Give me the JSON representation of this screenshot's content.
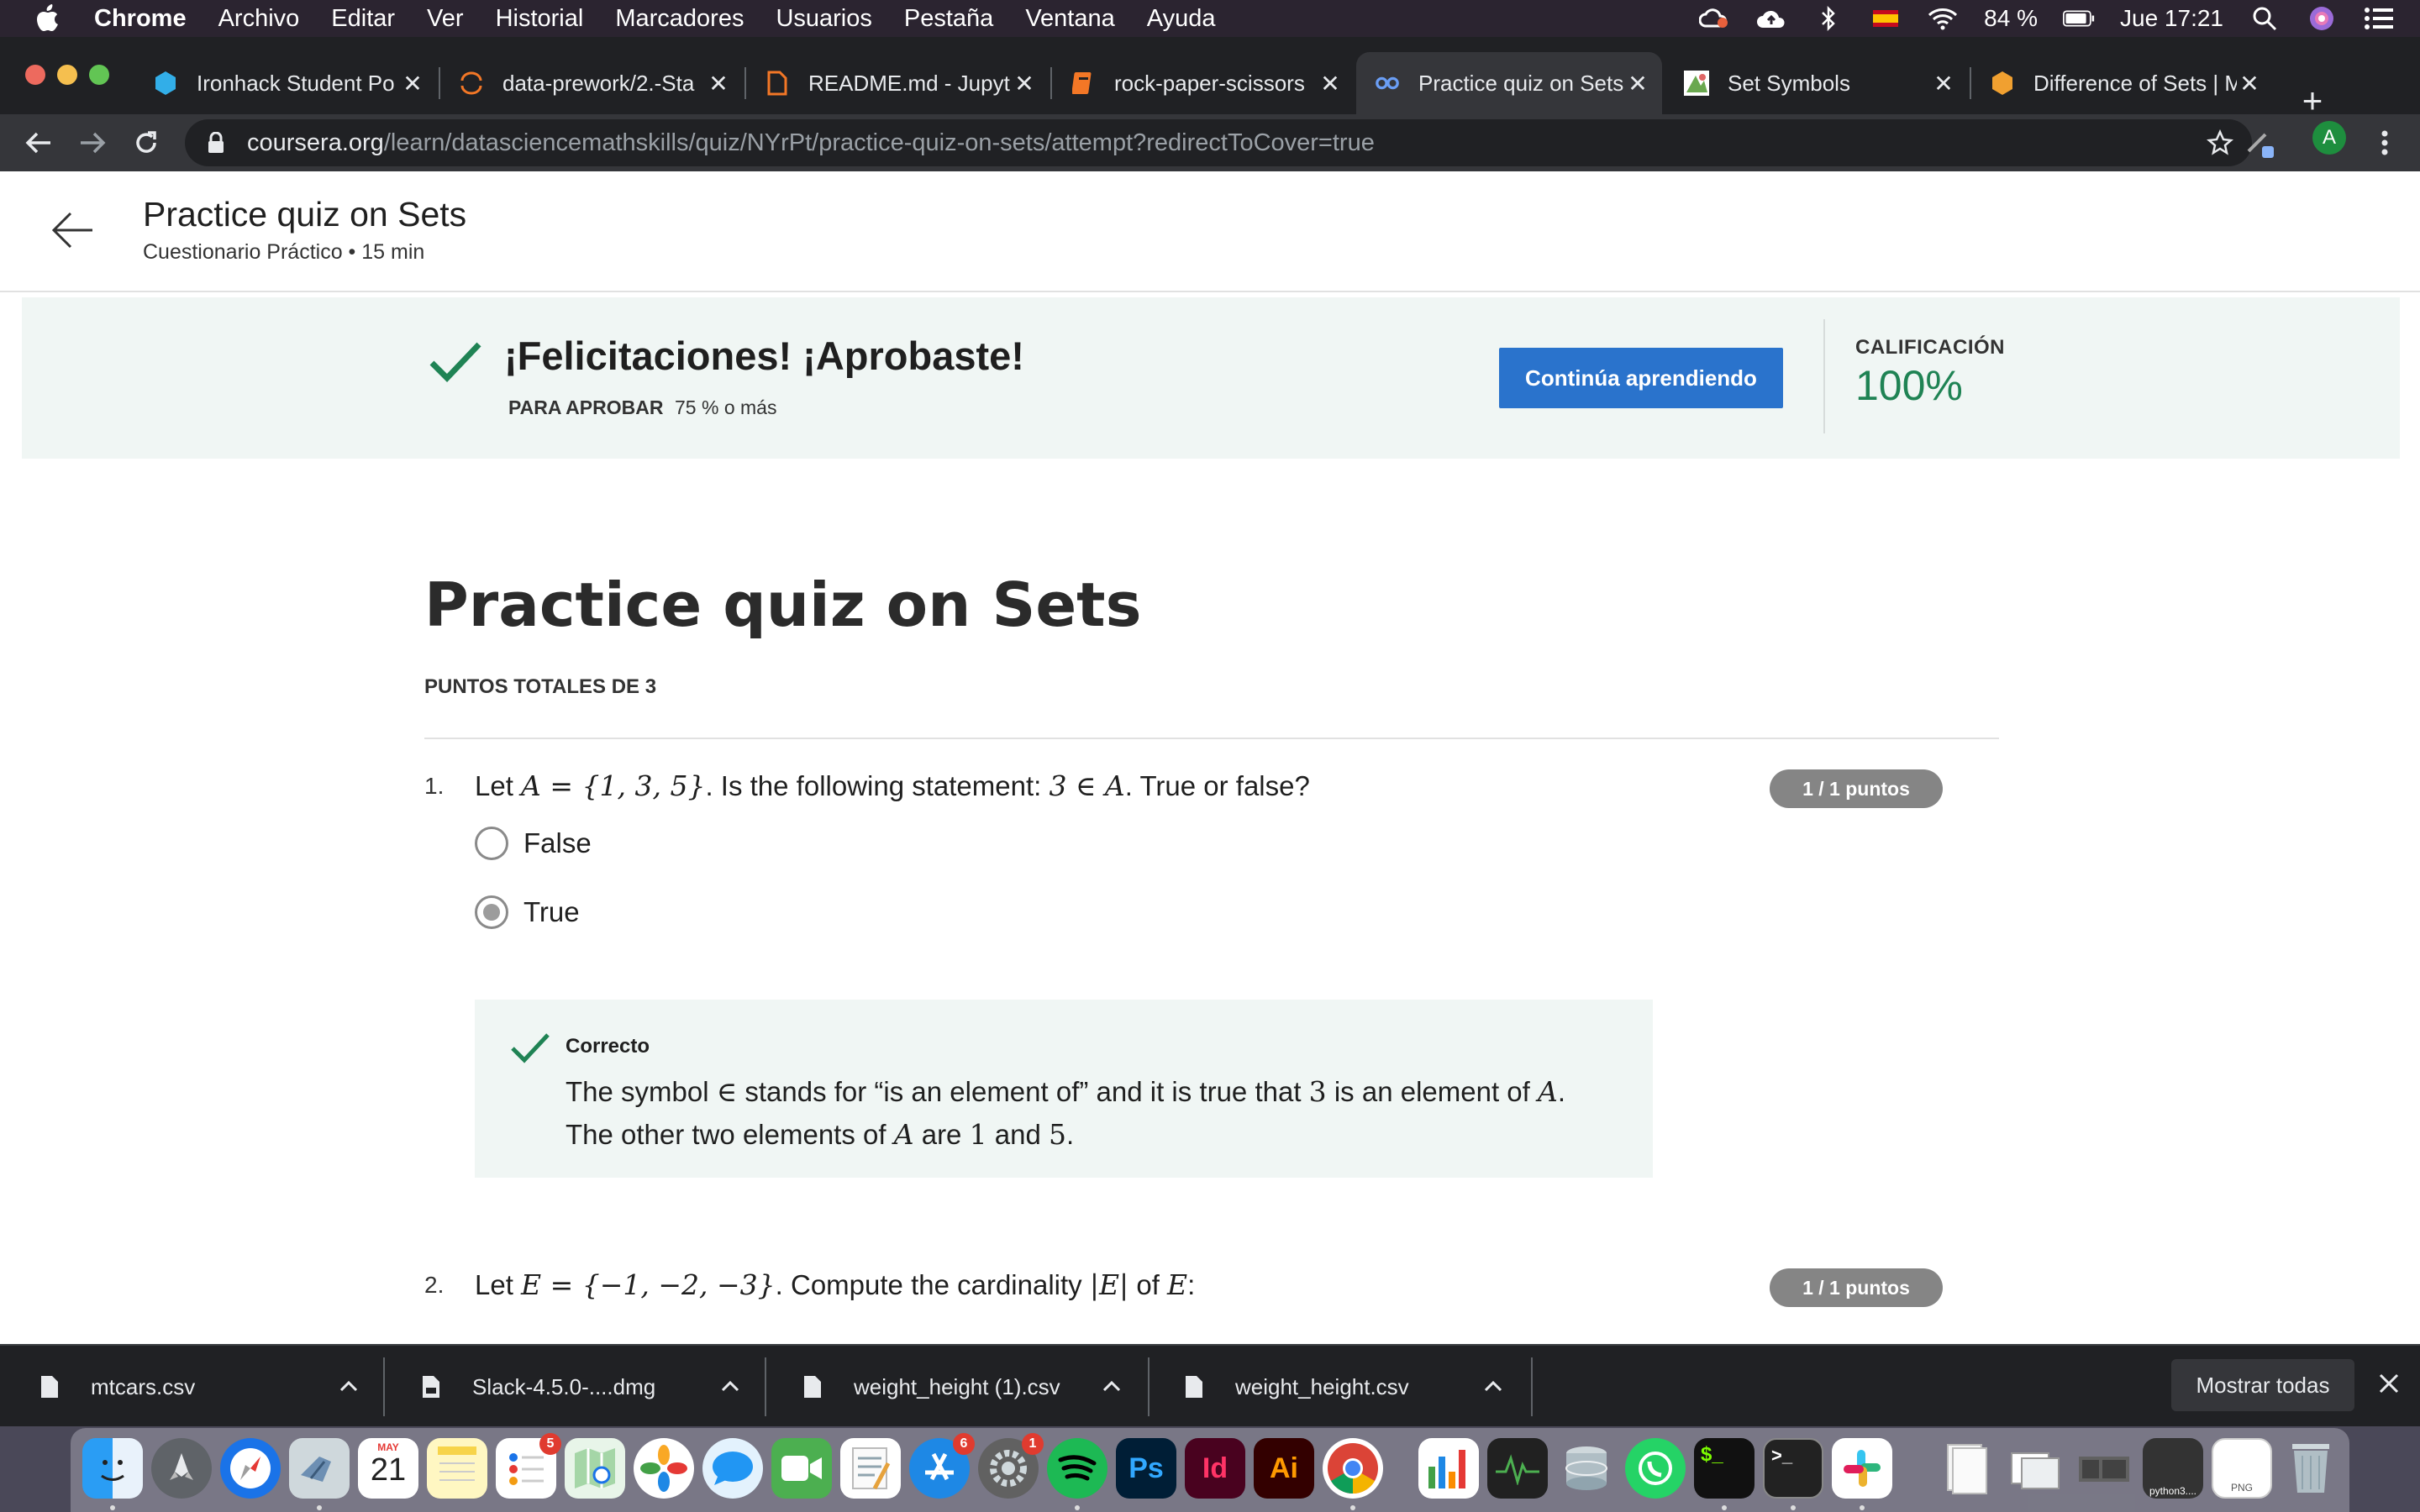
{
  "menubar": {
    "app": "Chrome",
    "items": [
      "Archivo",
      "Editar",
      "Ver",
      "Historial",
      "Marcadores",
      "Usuarios",
      "Pestaña",
      "Ventana",
      "Ayuda"
    ],
    "battery": "84 %",
    "datetime": "Jue 17:21"
  },
  "tabs": [
    {
      "title": "Ironhack Student Po",
      "icon": "ironhack-icon"
    },
    {
      "title": "data-prework/2.-Sta",
      "icon": "jupyter-icon"
    },
    {
      "title": "README.md - Jupyt",
      "icon": "file-icon"
    },
    {
      "title": "rock-paper-scissors",
      "icon": "notebook-icon"
    },
    {
      "title": "Practice quiz on Sets",
      "icon": "coursera-icon",
      "active": true
    },
    {
      "title": "Set Symbols",
      "icon": "set-symbols-icon"
    },
    {
      "title": "Difference of Sets | M",
      "icon": "hexagon-icon"
    }
  ],
  "omnibox": {
    "host": "coursera.org",
    "path": "/learn/datasciencemathskills/quiz/NYrPt/practice-quiz-on-sets/attempt?redirectToCover=true"
  },
  "profile_initial": "A",
  "header": {
    "title": "Practice quiz on Sets",
    "subtitle": "Cuestionario Práctico • 15 min"
  },
  "banner": {
    "title": "¡Felicitaciones! ¡Aprobaste!",
    "pass_label": "PARA APROBAR",
    "pass_value": "75 % o más",
    "continue_label": "Continúa aprendiendo",
    "grade_label": "CALIFICACIÓN",
    "grade_value": "100%"
  },
  "quiz": {
    "title": "Practice quiz on Sets",
    "total_points": "PUNTOS TOTALES DE 3",
    "questions": [
      {
        "number": "1.",
        "text_before": "Let ",
        "math1": "A = {1, 3, 5}",
        "text_mid": ". Is the following statement: ",
        "math2": "3 ∈ A",
        "text_after": ". True or false?",
        "points": "1 / 1 puntos",
        "options": [
          {
            "label": "False",
            "checked": false
          },
          {
            "label": "True",
            "checked": true
          }
        ],
        "feedback": {
          "label": "Correcto",
          "line1_a": "The symbol ",
          "line1_sym": "∈",
          "line1_b": " stands for “is an element of” and it is true that ",
          "line1_num": "3",
          "line1_c": " is an element of ",
          "line1_var": "A",
          "line1_d": ".",
          "line2_a": "The other two elements of ",
          "line2_var": "A",
          "line2_b": " are ",
          "line2_n1": "1",
          "line2_c": " and ",
          "line2_n2": "5",
          "line2_d": "."
        }
      },
      {
        "number": "2.",
        "text_before": "Let ",
        "math1": "E = {−1, −2, −3}",
        "text_mid": ". Compute the cardinality ",
        "math2": "|E|",
        "text_mid2": " of ",
        "math3": "E",
        "text_after": ":",
        "points": "1 / 1 puntos"
      }
    ]
  },
  "downloads": [
    {
      "name": "mtcars.csv"
    },
    {
      "name": "Slack-4.5.0-....dmg"
    },
    {
      "name": "weight_height (1).csv"
    },
    {
      "name": "weight_height.csv"
    }
  ],
  "show_all_label": "Mostrar todas",
  "dock": {
    "calendar_month": "MAY",
    "calendar_day": "21",
    "reminders_badge": "5",
    "appstore_badge": "6",
    "prefs_badge": "1",
    "ps_label": "Ps",
    "id_label": "Id",
    "ai_label": "Ai",
    "terminal_label": "$_",
    "terminal2_label": ">_",
    "python_label": "python3....",
    "png_label": "PNG"
  },
  "colors": {
    "accent_blue": "#2a73cc",
    "success_green": "#1f8354",
    "banner_bg": "#f0f6f4"
  }
}
